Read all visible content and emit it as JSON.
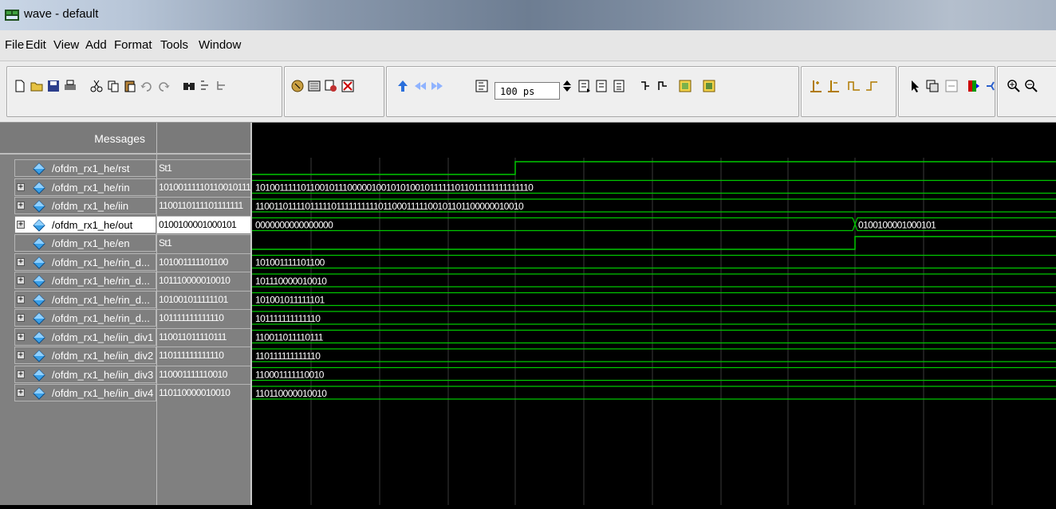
{
  "window": {
    "title": "wave - default"
  },
  "menu": [
    "File",
    "Edit",
    "View",
    "Add",
    "Format",
    "Tools",
    "Window"
  ],
  "toolbar": {
    "time_value": "100 ps"
  },
  "header": {
    "messages": "Messages"
  },
  "signals": [
    {
      "name": "/ofdm_rx1_he/rst",
      "value": "St1",
      "expandable": false,
      "wave": "St1"
    },
    {
      "name": "/ofdm_rx1_he/rin",
      "value": "101001111101100101110",
      "expandable": true,
      "wave": "1010011111011001011100000100101010010111111011011111111111110"
    },
    {
      "name": "/ofdm_rx1_he/iin",
      "value": "1100110111101111111",
      "expandable": true,
      "wave": "11001101111011111011111111110110001111100101101100000010010"
    },
    {
      "name": "/ofdm_rx1_he/out",
      "value": "0100100001000101",
      "expandable": true,
      "selected": true,
      "wave": "0000000000000000",
      "wave2": "0100100001000101"
    },
    {
      "name": "/ofdm_rx1_he/en",
      "value": "St1",
      "expandable": false,
      "wave": "St1"
    },
    {
      "name": "/ofdm_rx1_he/rin_d...",
      "value": "101001111101100",
      "expandable": true,
      "wave": "101001111101100"
    },
    {
      "name": "/ofdm_rx1_he/rin_d...",
      "value": "101110000010010",
      "expandable": true,
      "wave": "101110000010010"
    },
    {
      "name": "/ofdm_rx1_he/rin_d...",
      "value": "101001011111101",
      "expandable": true,
      "wave": "101001011111101"
    },
    {
      "name": "/ofdm_rx1_he/rin_d...",
      "value": "101111111111110",
      "expandable": true,
      "wave": "101111111111110"
    },
    {
      "name": "/ofdm_rx1_he/iin_div1",
      "value": "110011011110111",
      "expandable": true,
      "wave": "110011011110111"
    },
    {
      "name": "/ofdm_rx1_he/iin_div2",
      "value": "110111111111110",
      "expandable": true,
      "wave": "110111111111110"
    },
    {
      "name": "/ofdm_rx1_he/iin_div3",
      "value": "110001111110010",
      "expandable": true,
      "wave": "110001111110010"
    },
    {
      "name": "/ofdm_rx1_he/iin_div4",
      "value": "110110000010010",
      "expandable": true,
      "wave": "110110000010010"
    }
  ],
  "colors": {
    "wave": "#00c800",
    "cursor_grid": "#3a3a3a",
    "selected_row": "#ffffff"
  }
}
